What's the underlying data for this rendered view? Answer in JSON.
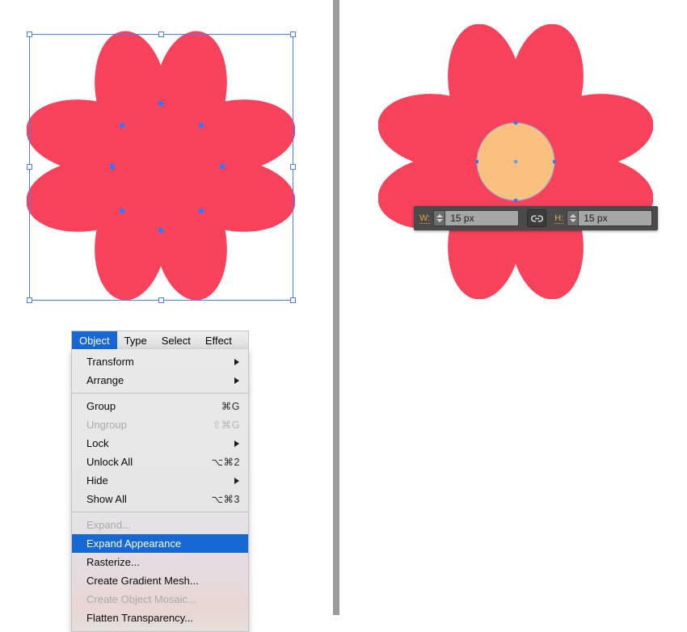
{
  "app": {
    "canvas_background": "#ffffff",
    "divider_color": "#9a9a9a"
  },
  "artwork": {
    "petal_color": "#f8415b",
    "center_color": "#f9c080",
    "selection_color": "#4d7cf3",
    "left_flower": {
      "name": "flower-8-petals",
      "petal_count": 8,
      "selected": true,
      "has_center": false
    },
    "right_flower": {
      "name": "flower-8-petals-with-center",
      "petal_count": 8,
      "selected_object": "center-circle",
      "has_center": true
    }
  },
  "hud": {
    "width_label": "W:",
    "width_value": "15 px",
    "height_label": "H:",
    "height_value": "15 px",
    "link_icon": "link-chain-icon",
    "link_active": true,
    "stepper_up_icon": "triangle-up-icon",
    "stepper_down_icon": "triangle-down-icon"
  },
  "menubar": {
    "items": [
      {
        "label": "Object",
        "active": true
      },
      {
        "label": "Type",
        "active": false
      },
      {
        "label": "Select",
        "active": false
      },
      {
        "label": "Effect",
        "active": false
      }
    ]
  },
  "menu": {
    "title": "Object",
    "groups": [
      {
        "items": [
          {
            "label": "Transform",
            "shortcut": "",
            "submenu": true,
            "disabled": false,
            "selected": false
          },
          {
            "label": "Arrange",
            "shortcut": "",
            "submenu": true,
            "disabled": false,
            "selected": false
          }
        ]
      },
      {
        "items": [
          {
            "label": "Group",
            "shortcut": "⌘G",
            "submenu": false,
            "disabled": false,
            "selected": false
          },
          {
            "label": "Ungroup",
            "shortcut": "⇧⌘G",
            "submenu": false,
            "disabled": true,
            "selected": false
          },
          {
            "label": "Lock",
            "shortcut": "",
            "submenu": true,
            "disabled": false,
            "selected": false
          },
          {
            "label": "Unlock All",
            "shortcut": "⌥⌘2",
            "submenu": false,
            "disabled": false,
            "selected": false
          },
          {
            "label": "Hide",
            "shortcut": "",
            "submenu": true,
            "disabled": false,
            "selected": false
          },
          {
            "label": "Show All",
            "shortcut": "⌥⌘3",
            "submenu": false,
            "disabled": false,
            "selected": false
          }
        ]
      },
      {
        "items": [
          {
            "label": "Expand...",
            "shortcut": "",
            "submenu": false,
            "disabled": true,
            "selected": false
          },
          {
            "label": "Expand Appearance",
            "shortcut": "",
            "submenu": false,
            "disabled": false,
            "selected": true
          },
          {
            "label": "Rasterize...",
            "shortcut": "",
            "submenu": false,
            "disabled": false,
            "selected": false
          },
          {
            "label": "Create Gradient Mesh...",
            "shortcut": "",
            "submenu": false,
            "disabled": false,
            "selected": false
          },
          {
            "label": "Create Object Mosaic...",
            "shortcut": "",
            "submenu": false,
            "disabled": true,
            "selected": false
          },
          {
            "label": "Flatten Transparency...",
            "shortcut": "",
            "submenu": false,
            "disabled": false,
            "selected": false
          }
        ]
      }
    ]
  }
}
